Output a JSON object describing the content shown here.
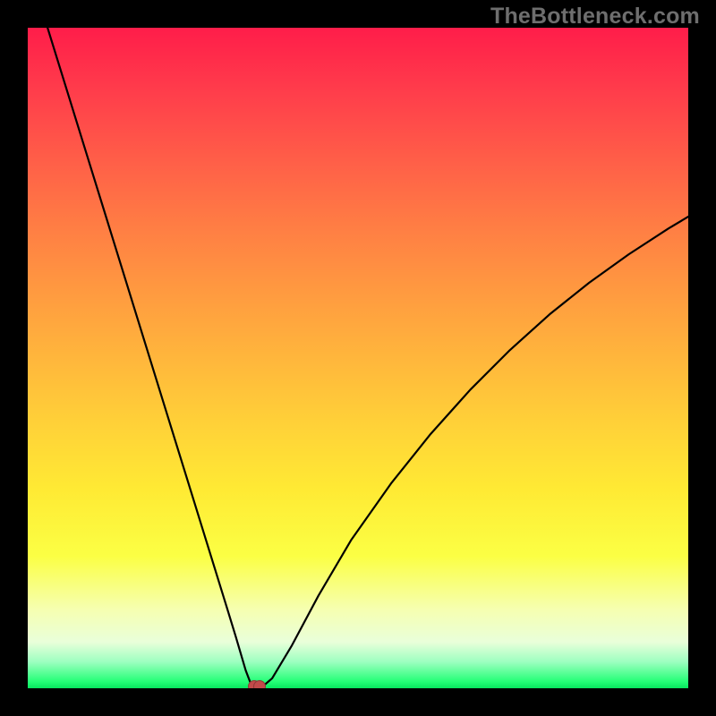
{
  "watermark": "TheBottleneck.com",
  "chart_data": {
    "type": "line",
    "title": "",
    "xlabel": "",
    "ylabel": "",
    "xlim": [
      0,
      100
    ],
    "ylim": [
      0,
      100
    ],
    "grid": false,
    "series": [
      {
        "name": "curve",
        "x": [
          3,
          6,
          9,
          12,
          15,
          18,
          21,
          24,
          27,
          30,
          31.5,
          33,
          33.8,
          34.6,
          35.6,
          37,
          40,
          44,
          49,
          55,
          61,
          67,
          73,
          79,
          85,
          91,
          97,
          100
        ],
        "values": [
          100,
          90.3,
          80.6,
          70.9,
          61.2,
          51.5,
          41.8,
          32.1,
          22.4,
          12.7,
          7.8,
          2.7,
          0.6,
          0.2,
          0.3,
          1.5,
          6.5,
          14,
          22.5,
          31,
          38.5,
          45.2,
          51.2,
          56.6,
          61.4,
          65.7,
          69.6,
          71.4
        ]
      }
    ],
    "markers": [
      {
        "x": 34.2,
        "y": 0.6
      },
      {
        "x": 35,
        "y": 0.6
      }
    ],
    "gradient_stops": [
      {
        "pos": 0,
        "color": "#ff1d4a"
      },
      {
        "pos": 50,
        "color": "#ffb63c"
      },
      {
        "pos": 80,
        "color": "#fbff44"
      },
      {
        "pos": 100,
        "color": "#07e65e"
      }
    ]
  }
}
